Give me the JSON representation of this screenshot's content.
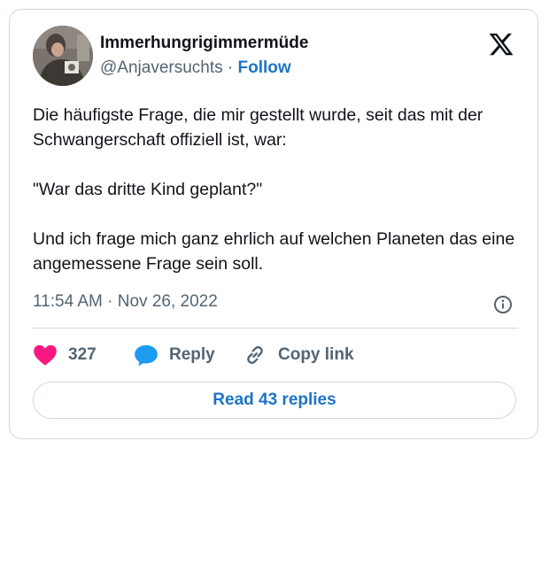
{
  "tweet": {
    "display_name": "Immerhungrigimmermüde",
    "handle": "@Anjaversuchts",
    "separator": " · ",
    "follow_label": "Follow",
    "text": "Die häufigste Frage, die mir gestellt wurde, seit das mit der Schwangerschaft offiziell ist, war:\n\n\"War das dritte Kind geplant?\"\n\nUnd ich frage mich ganz ehrlich auf welchen Planeten das eine angemessene Frage sein soll.",
    "timestamp": "11:54 AM · Nov 26, 2022"
  },
  "actions": {
    "likes_count": "327",
    "reply_label": "Reply",
    "copy_link_label": "Copy link"
  },
  "read_replies_label": "Read 43 replies",
  "icons": {
    "logo": "x-logo-icon",
    "like": "heart-icon",
    "reply": "speech-bubble-icon",
    "copy": "link-icon",
    "info": "info-icon"
  },
  "colors": {
    "like": "#f91880",
    "reply": "#1d9bf0",
    "link": "#1d74c6",
    "secondary_text": "#536471",
    "border": "#cfd9de"
  }
}
